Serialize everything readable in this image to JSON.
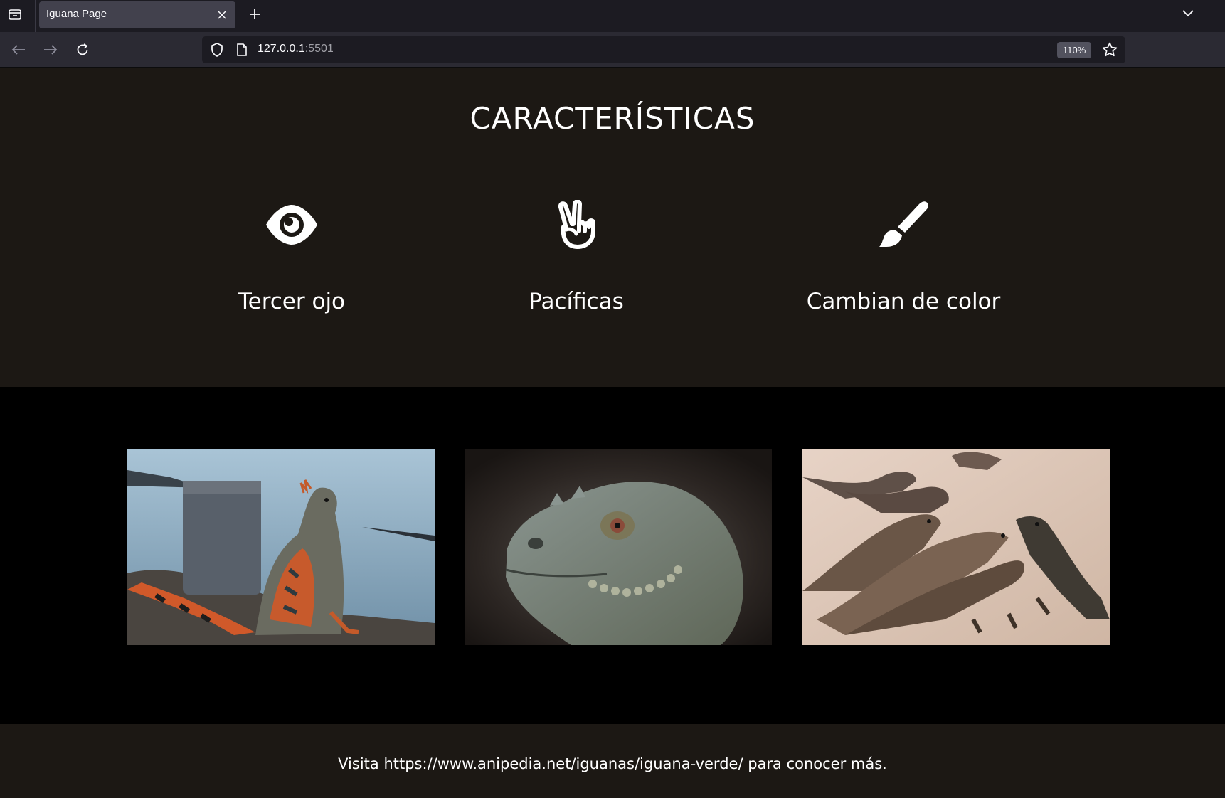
{
  "browser": {
    "tab_title": "Iguana Page",
    "url_host": "127.0.0.1",
    "url_port": ":5501",
    "zoom": "110%",
    "icons": [
      "tab-overview-icon",
      "close-icon",
      "plus-icon",
      "chevron-down-icon",
      "back-arrow-icon",
      "forward-arrow-icon",
      "reload-icon",
      "shield-icon",
      "page-icon",
      "star-icon"
    ]
  },
  "features": {
    "title": "CARACTERÍSTICAS",
    "items": [
      {
        "label": "Tercer ojo",
        "icon": "eye-icon"
      },
      {
        "label": "Pacíficas",
        "icon": "peace-hand-icon"
      },
      {
        "label": "Cambian de color",
        "icon": "paint-brush-icon"
      }
    ]
  },
  "gallery": {
    "photos": [
      {
        "subject": "iguana-on-rock-by-water"
      },
      {
        "subject": "iguana-head-closeup"
      },
      {
        "subject": "iguanas-on-sand"
      }
    ]
  },
  "footer": {
    "text": "Visita https://www.anipedia.net/iguanas/iguana-verde/ para conocer más."
  },
  "colors": {
    "page_bg": "#1c1814",
    "gallery_bg": "#000000",
    "text": "#ffffff"
  }
}
